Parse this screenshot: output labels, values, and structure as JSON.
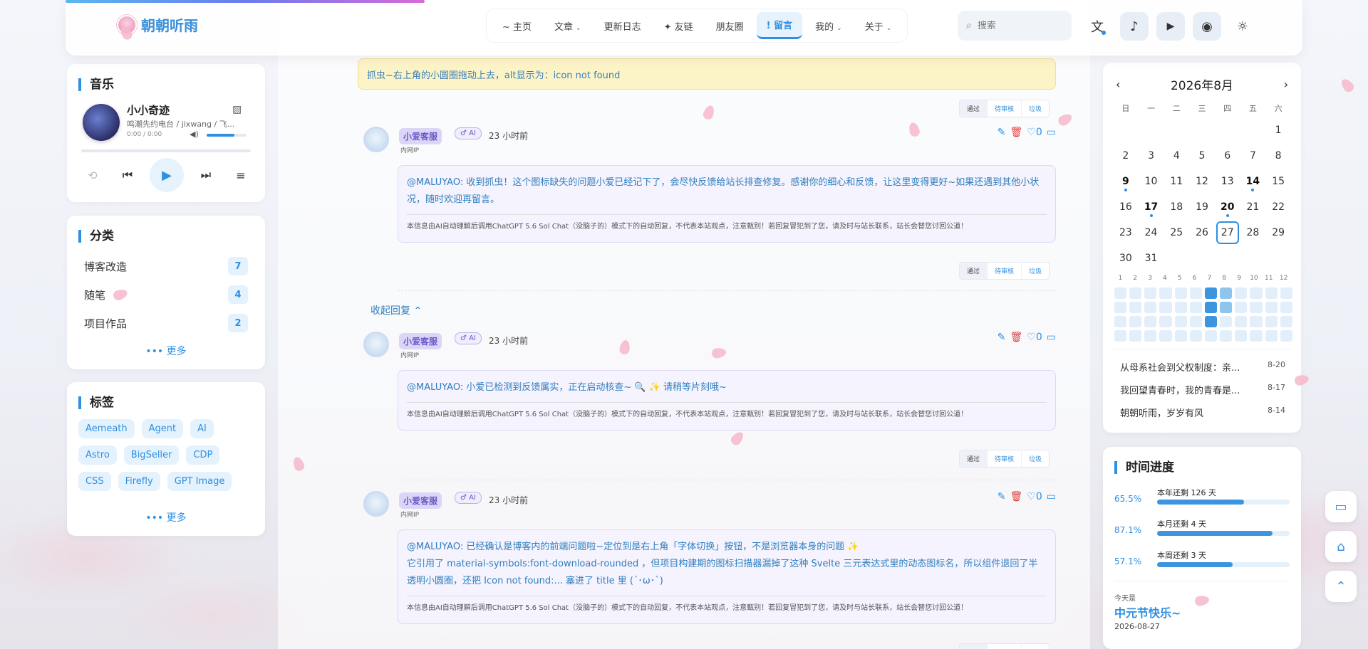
{
  "site": {
    "logo_text": "朝朝听雨"
  },
  "nav": {
    "items": [
      {
        "label": "~ 主页",
        "has_caret": false
      },
      {
        "label": "文章",
        "has_caret": true
      },
      {
        "label": "更新日志",
        "has_caret": false
      },
      {
        "label": "✦ 友链",
        "has_caret": false
      },
      {
        "label": "朋友圈",
        "has_caret": false
      },
      {
        "label": "! 留言",
        "has_caret": false,
        "active": true
      },
      {
        "label": "我的",
        "has_caret": true
      },
      {
        "label": "关于",
        "has_caret": true
      }
    ],
    "caret": "⌄"
  },
  "search": {
    "placeholder": "搜索"
  },
  "header_buttons": {
    "translate": "文",
    "music": "♪",
    "play": "▶",
    "palette": "◉",
    "theme": "☼"
  },
  "music": {
    "title": "音乐",
    "song": "小小奇迹",
    "artist": "鸣潮先约电台 / jixwang / 飞...",
    "time": "0:00 / 0:00",
    "volume_fraction": 0.7,
    "controls": {
      "repeat": "⟲",
      "prev": "⏮",
      "play": "▶",
      "next": "⏭",
      "playlist": "≡"
    }
  },
  "categories": {
    "title": "分类",
    "items": [
      {
        "name": "博客改造",
        "count": "7"
      },
      {
        "name": "随笔",
        "count": "4"
      },
      {
        "name": "项目作品",
        "count": "2"
      }
    ],
    "more": "••• 更多"
  },
  "tags": {
    "title": "标签",
    "items": [
      "Aemeath",
      "Agent",
      "AI",
      "Astro",
      "BigSeller",
      "CDP",
      "CSS",
      "Firefly",
      "GPT Image"
    ],
    "more": "••• 更多"
  },
  "notice": "抓虫~右上角的小圆圈拖动上去，alt显示为：icon not found",
  "moderation": {
    "approve": "通过",
    "pending": "待审核",
    "spam": "垃圾"
  },
  "collapse_label": "收起回复 ⌃",
  "comments": [
    {
      "name": "小爱客服",
      "ai_badge": "♂ AI",
      "time": "23 小时前",
      "ip": "内网IP",
      "likes": "0",
      "text_lines": [
        "@MALUYAO: 收到抓虫！这个图标缺失的问题小爱已经记下了，会尽快反馈给站长排查修复。感谢你的细心和反馈，让这里变得更好~如果还遇到其他小状况，随时欢迎再留言。"
      ],
      "disclaimer": "本信息由AI自动理解后调用ChatGPT 5.6 Sol Chat（没脑子的）模式下的自动回复，不代表本站观点，注意甄别！若回复冒犯到了您，请及时与站长联系，站长会替您讨回公道！"
    },
    {
      "name": "小爱客服",
      "ai_badge": "♂ AI",
      "time": "23 小时前",
      "ip": "内网IP",
      "likes": "0",
      "text_lines": [
        "@MALUYAO: 小爱已检测到反馈属实，正在启动核查~ 🔍 ✨ 请稍等片刻哦~"
      ],
      "disclaimer": "本信息由AI自动理解后调用ChatGPT 5.6 Sol Chat（没脑子的）模式下的自动回复，不代表本站观点，注意甄别！若回复冒犯到了您，请及时与站长联系，站长会替您讨回公道！"
    },
    {
      "name": "小爱客服",
      "ai_badge": "♂ AI",
      "time": "23 小时前",
      "ip": "内网IP",
      "likes": "0",
      "text_lines": [
        "@MALUYAO: 已经确认是博客内的前端问题啦~定位到是右上角「字体切换」按钮，不是浏览器本身的问题 ✨",
        "它引用了 material-symbols:font-download-rounded ，但项目构建期的图标扫描器漏掉了这种 Svelte 三元表达式里的动态图标名，所以组件退回了半透明小圆圈，还把 Icon not found:... 塞进了 title 里 (´･ω･`)"
      ],
      "disclaimer": "本信息由AI自动理解后调用ChatGPT 5.6 Sol Chat（没脑子的）模式下的自动回复，不代表本站观点，注意甄别！若回复冒犯到了您，请及时与站长联系，站长会替您讨回公道！"
    }
  ],
  "calendar": {
    "title": "2026年8月",
    "prev": "‹",
    "next": "›",
    "weekdays": [
      "日",
      "一",
      "二",
      "三",
      "四",
      "五",
      "六"
    ],
    "leading_blanks": 6,
    "days": 31,
    "bold_days": [
      9,
      14,
      17,
      20
    ],
    "dot_days": [
      9,
      14,
      17,
      20
    ],
    "today": 27,
    "heat_months": [
      "1",
      "2",
      "3",
      "4",
      "5",
      "6",
      "7",
      "8",
      "9",
      "10",
      "11",
      "12"
    ],
    "heat_levels": [
      [
        0,
        0,
        0,
        0,
        0,
        0,
        2,
        1,
        0,
        0,
        0,
        0
      ],
      [
        0,
        0,
        0,
        0,
        0,
        0,
        2,
        1,
        0,
        0,
        0,
        0
      ],
      [
        0,
        0,
        0,
        0,
        0,
        0,
        2,
        0,
        0,
        0,
        0,
        0
      ],
      [
        0,
        0,
        0,
        0,
        0,
        0,
        0,
        0,
        0,
        0,
        0,
        0
      ]
    ],
    "recent_posts": [
      {
        "title": "从母系社会到父权制度：亲...",
        "date": "8-20"
      },
      {
        "title": "我回望青春时，我的青春是...",
        "date": "8-17"
      },
      {
        "title": "朝朝听雨，岁岁有风",
        "date": "8-14"
      }
    ]
  },
  "time_progress": {
    "title": "时间进度",
    "rows": [
      {
        "percent": "65.5%",
        "label": "本年还剩 126 天",
        "fraction": 0.655
      },
      {
        "percent": "87.1%",
        "label": "本月还剩 4 天",
        "fraction": 0.871
      },
      {
        "percent": "57.1%",
        "label": "本周还剩 3 天",
        "fraction": 0.571
      }
    ],
    "today_label": "今天是",
    "festival": "中元节快乐~",
    "date": "2026-08-27"
  },
  "fab": {
    "chat": "▭",
    "home": "⌂",
    "top": "⌃"
  },
  "colors": {
    "accent": "#2f8fe0",
    "delete": "#e03c3c",
    "notice_bg": "#fcf4c7"
  }
}
